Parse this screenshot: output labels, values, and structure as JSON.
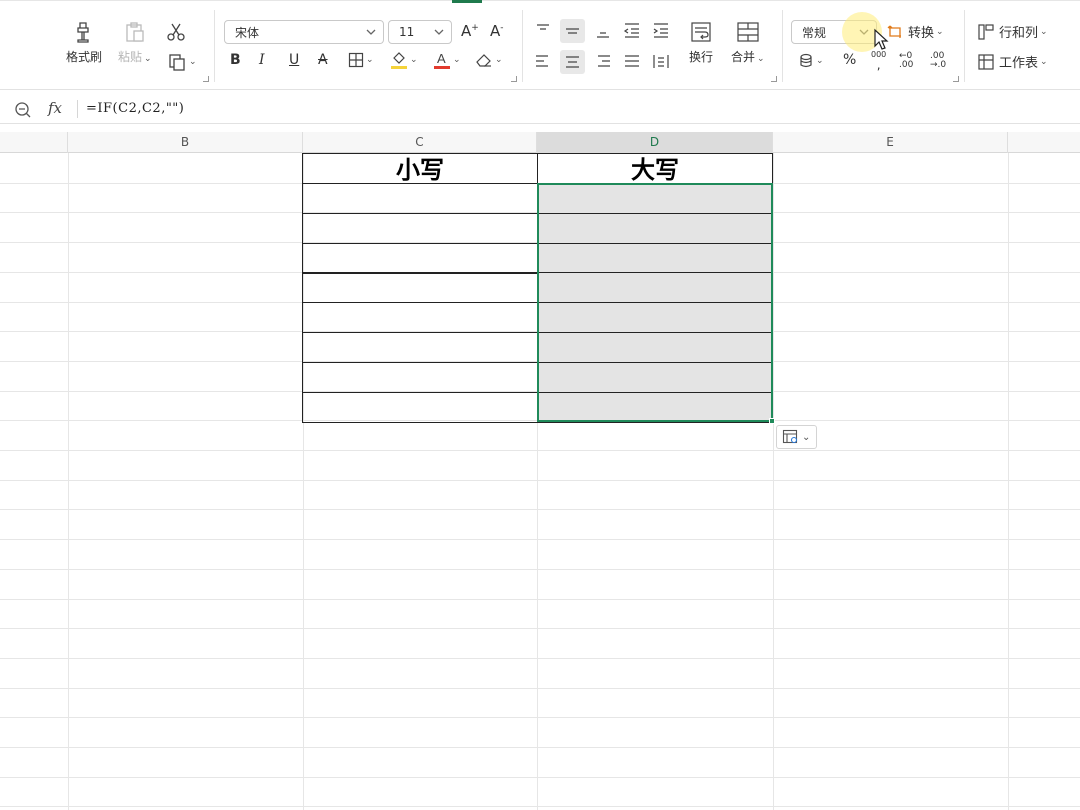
{
  "ribbon": {
    "clipboard": {
      "format_painter": "格式刷",
      "paste": "粘贴",
      "paste_caret": "⌄"
    },
    "font": {
      "name": "宋体",
      "size": "11",
      "bold": "B",
      "italic": "I",
      "underline": "U",
      "strikethrough": "A"
    },
    "alignment": {
      "wrap": "换行",
      "merge": "合并"
    },
    "number": {
      "format": "常规",
      "convert": "转换",
      "percent": "%",
      "thousands": "000"
    },
    "cells": {
      "rows_cols": "行和列",
      "worksheet": "工作表"
    },
    "colors": {
      "highlight": "#f5d33a",
      "font_color": "#e23b2e",
      "accent": "#1f8a5a"
    }
  },
  "formula_bar": {
    "fx": "fx",
    "formula": "=IF(C2,C2,\"\")"
  },
  "columns": [
    {
      "label": "B"
    },
    {
      "label": "C"
    },
    {
      "label": "D"
    },
    {
      "label": "E"
    }
  ],
  "table": {
    "header_c": "小写",
    "header_d": "大写",
    "rows": 8
  }
}
